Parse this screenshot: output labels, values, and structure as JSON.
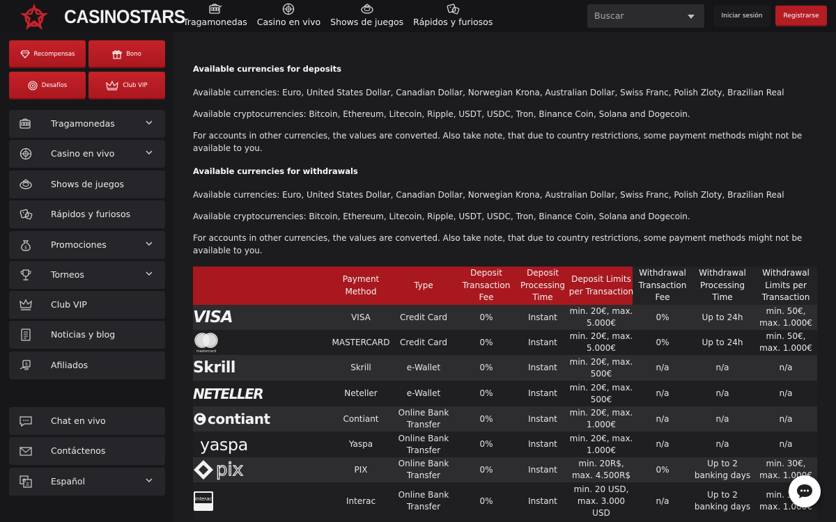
{
  "header": {
    "brand": "CASINOSTARS",
    "nav": [
      {
        "label": "Tragamonedas",
        "icon": "slot-machine-icon"
      },
      {
        "label": "Casino en vivo",
        "icon": "roulette-icon"
      },
      {
        "label": "Shows de juegos",
        "icon": "game-show-icon"
      },
      {
        "label": "Rápidos y furiosos",
        "icon": "dice-icon"
      }
    ],
    "search_placeholder": "Buscar",
    "login_label": "Iniciar sesión",
    "register_label": "Registrarse"
  },
  "sidebar": {
    "promos": [
      {
        "label": "Recompensas",
        "icon": "diamond-icon"
      },
      {
        "label": "Bono",
        "icon": "gift-icon"
      },
      {
        "label": "Desafíos",
        "icon": "target-icon"
      },
      {
        "label": "Club VIP",
        "icon": "crown-icon"
      }
    ],
    "items": [
      {
        "label": "Tragamonedas",
        "icon": "slot-machine-icon",
        "expandable": true
      },
      {
        "label": "Casino en vivo",
        "icon": "roulette-icon",
        "expandable": true
      },
      {
        "label": "Shows de juegos",
        "icon": "game-show-icon",
        "expandable": false
      },
      {
        "label": "Rápidos y furiosos",
        "icon": "dice-icon",
        "expandable": false
      },
      {
        "label": "Promociones",
        "icon": "money-bag-icon",
        "expandable": true
      },
      {
        "label": "Torneos",
        "icon": "trophy-icon",
        "expandable": true
      },
      {
        "label": "Club VIP",
        "icon": "crown-icon",
        "expandable": false
      },
      {
        "label": "Noticias y blog",
        "icon": "news-icon",
        "expandable": false
      },
      {
        "label": "Afiliados",
        "icon": "affiliate-icon",
        "expandable": false
      }
    ],
    "bottom_items": [
      {
        "label": "Chat en vivo",
        "icon": "chat-icon",
        "expandable": false
      },
      {
        "label": "Contáctenos",
        "icon": "mail-icon",
        "expandable": false
      },
      {
        "label": "Español",
        "icon": "language-icon",
        "expandable": true
      }
    ]
  },
  "content": {
    "deposits_heading": "Available currencies for deposits",
    "deposits_currencies": "Available currencies: Euro, United States Dollar, Canadian Dollar, Norwegian Krona, Australian Dollar, Swiss Franc, Polish Zloty, Brazilian Real",
    "deposits_crypto": "Available cryptocurrencies: Bitcoin, Ethereum, Litecoin, Ripple, USDT, USDC, Tron, Binance Coin, Solana and Dogecoin.",
    "deposits_note": "For accounts in other currencies, the values are converted. Also take note, that due to country restrictions, some payment methods might not be available to you.",
    "withdrawals_heading": "Available currencies for withdrawals",
    "withdrawals_currencies": "Available currencies: Euro, United States Dollar, Canadian Dollar, Norwegian Krona, Australian Dollar, Swiss Franc, Polish Zloty, Brazilian Real",
    "withdrawals_crypto": "Available cryptocurrencies: Bitcoin, Ethereum, Litecoin, Ripple, USDT, USDC, Tron, Binance Coin, Solana and Dogecoin.",
    "withdrawals_note": "For accounts in other currencies, the values are converted. Also take note, that due to country restrictions, some payment methods might not be available to you."
  },
  "table": {
    "headers": [
      "Payment Method",
      "Type",
      "Deposit Transaction Fee",
      "Deposit Processing Time",
      "Deposit Limits per Transaction",
      "Withdrawal Transaction Fee",
      "Withdrawal Processing Time",
      "Withdrawal Limits per Transaction"
    ],
    "rows": [
      {
        "logo": "VISA",
        "method": "VISA",
        "type": "Credit Card",
        "dep_fee": "0%",
        "dep_time": "Instant",
        "dep_limits": "min. 20€, max. 5.000€",
        "wd_fee": "0%",
        "wd_time": "Up to 24h",
        "wd_limits": "min. 50€, max. 1.000€"
      },
      {
        "logo": "mastercard",
        "method": "MASTERCARD",
        "type": "Credit Card",
        "dep_fee": "0%",
        "dep_time": "Instant",
        "dep_limits": "min. 20€, max. 5.000€",
        "wd_fee": "0%",
        "wd_time": "Up to 24h",
        "wd_limits": "min. 50€, max. 1.000€"
      },
      {
        "logo": "Skrill",
        "method": "Skrill",
        "type": "e-Wallet",
        "dep_fee": "0%",
        "dep_time": "Instant",
        "dep_limits": "min. 20€, max. 500€",
        "wd_fee": "n/a",
        "wd_time": "n/a",
        "wd_limits": "n/a"
      },
      {
        "logo": "NETELLER",
        "method": "Neteller",
        "type": "e-Wallet",
        "dep_fee": "0%",
        "dep_time": "Instant",
        "dep_limits": "min. 20€, max. 500€",
        "wd_fee": "n/a",
        "wd_time": "n/a",
        "wd_limits": "n/a"
      },
      {
        "logo": "contiant",
        "method": "Contiant",
        "type": "Online Bank Transfer",
        "dep_fee": "0%",
        "dep_time": "Instant",
        "dep_limits": "min. 20€, max. 1.000€",
        "wd_fee": "n/a",
        "wd_time": "n/a",
        "wd_limits": "n/a"
      },
      {
        "logo": "yaspa",
        "method": "Yaspa",
        "type": "Online Bank Transfer",
        "dep_fee": "0%",
        "dep_time": "Instant",
        "dep_limits": "min. 20€, max. 1.000€",
        "wd_fee": "n/a",
        "wd_time": "n/a",
        "wd_limits": "n/a"
      },
      {
        "logo": "pix",
        "method": "PIX",
        "type": "Online Bank Transfer",
        "dep_fee": "0%",
        "dep_time": "Instant",
        "dep_limits": "min. 20R$, max. 4.500R$",
        "wd_fee": "0%",
        "wd_time": "Up to 2 banking days",
        "wd_limits": "min. 30€, max. 1.000€"
      },
      {
        "logo": "Interac",
        "method": "Interac",
        "type": "Online Bank Transfer",
        "dep_fee": "0%",
        "dep_time": "Instant",
        "dep_limits": "min. 20 USD, max. 3.000 USD",
        "wd_fee": "n/a",
        "wd_time": "Up to 2 banking days",
        "wd_limits": "min. 30€, max. 1.000€"
      }
    ]
  },
  "colors": {
    "accent_red": "#b41d24",
    "sidebar_bg": "#17171a",
    "item_bg": "#26262a",
    "main_bg": "#1c1c1f"
  }
}
